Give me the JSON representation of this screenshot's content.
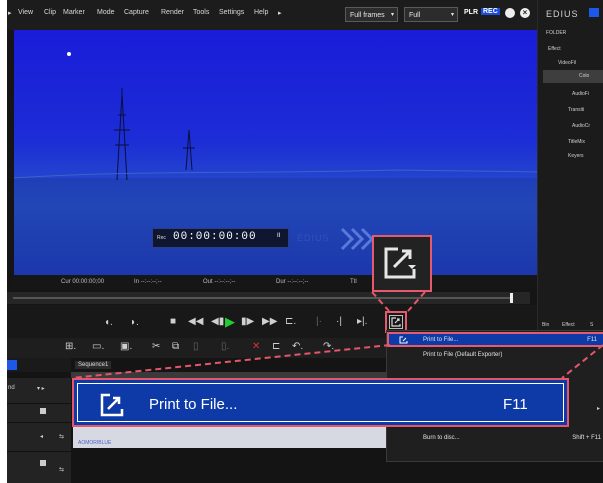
{
  "menu": {
    "items": [
      "View",
      "Clip",
      "Marker",
      "Mode",
      "Capture",
      "Render",
      "Tools",
      "Settings",
      "Help"
    ],
    "more": "▸",
    "fullframes": "Full frames",
    "quality": "Full",
    "plr": "PLR",
    "rec": "REC"
  },
  "preview": {
    "timecode_label": "Rec",
    "timecode": "00:00:00:00",
    "marker": "II",
    "watermark": "EDIUS"
  },
  "status": {
    "cur": "Cur 00:00:00;00",
    "in": "In --:--:--;--",
    "out": "Out --:--:--;--",
    "dur": "Dur --:--:--;--",
    "ttl": "Ttl"
  },
  "right_panel": {
    "brand": "EDIUS",
    "folder_label": "FOLDER",
    "tree": [
      "Effect",
      "VideoFil",
      "Colo",
      "AudioFi",
      "Transiti",
      "AudioCr",
      "TitleMix",
      "Keyers"
    ],
    "tabs": [
      "Bin",
      "Effect",
      "S"
    ]
  },
  "timeline": {
    "sequence_tab": "Sequence1",
    "clip_name": "AOMORIBLUE",
    "track_label": "nd"
  },
  "context_menu": {
    "items": [
      {
        "label": "Print to File...",
        "shortcut": "F11"
      },
      {
        "label": "Print to File (Default Exporter)",
        "shortcut": ""
      },
      {
        "label": "Burn to disc...",
        "shortcut": "Shift + F11"
      }
    ]
  },
  "banner": {
    "label": "Print to File...",
    "shortcut": "F11"
  },
  "colors": {
    "accent_red": "#e6566a",
    "highlight_blue": "#0d3aa6",
    "preview_blue": "#1c2dd6"
  }
}
